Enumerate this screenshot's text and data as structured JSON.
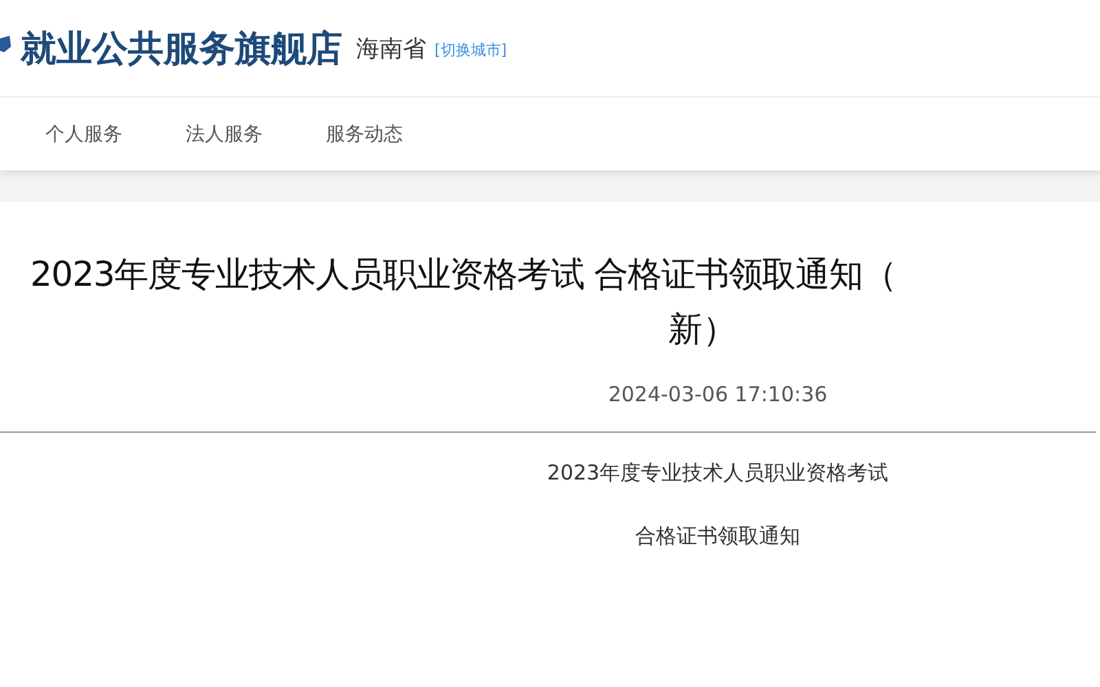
{
  "header": {
    "site_title": "就业公共服务旗舰店",
    "province": "海南省",
    "switch_city": "[切换城市]"
  },
  "nav": [
    {
      "label": "个人服务"
    },
    {
      "label": "法人服务"
    },
    {
      "label": "服务动态"
    }
  ],
  "article": {
    "title_lines": [
      "2023年度专业技术人员职业资格考试 合格证书领取通知（",
      "新）"
    ],
    "date": "2024-03-06 17:10:36",
    "body_lines": [
      "2023年度专业技术人员职业资格考试",
      "合格证书领取通知"
    ]
  }
}
